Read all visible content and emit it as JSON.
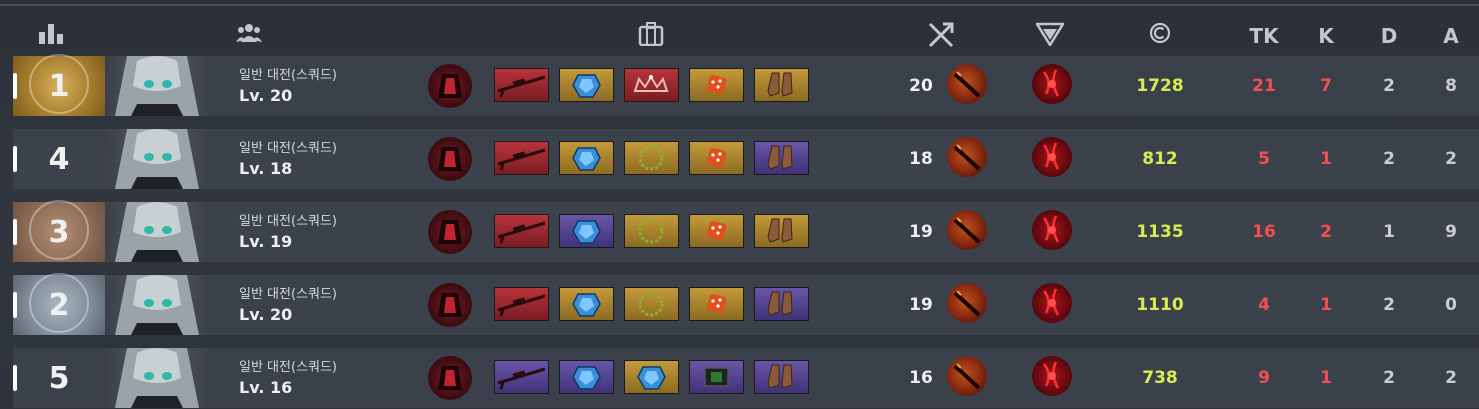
{
  "header": {
    "icons": [
      "ranking-icon",
      "team-icon",
      "inventory-icon",
      "weapon-icon",
      "skill-icon",
      "credit-icon"
    ],
    "tk": "TK",
    "k": "K",
    "d": "D",
    "a": "A"
  },
  "colors": {
    "credits": "#d8ec52",
    "tk_k": "#f05050",
    "text": "#eceef2"
  },
  "rows": [
    {
      "rank": "1",
      "rank_style": "gold",
      "mode": "일반 대전(스쿼드)",
      "level": "Lv. 20",
      "items": [
        "sniper-rifle-red",
        "armor-gold",
        "crown-red",
        "dice-gold",
        "boots-gold"
      ],
      "weapon_level": "20",
      "credits": "1728",
      "tk": "21",
      "k": "7",
      "d": "2",
      "a": "8"
    },
    {
      "rank": "4",
      "rank_style": "plain",
      "mode": "일반 대전(스쿼드)",
      "level": "Lv. 18",
      "items": [
        "sniper-rifle-red",
        "armor-gold",
        "wreath-gold",
        "dice-gold",
        "boots-purple"
      ],
      "weapon_level": "18",
      "credits": "812",
      "tk": "5",
      "k": "1",
      "d": "2",
      "a": "2"
    },
    {
      "rank": "3",
      "rank_style": "bronze",
      "mode": "일반 대전(스쿼드)",
      "level": "Lv. 19",
      "items": [
        "sniper-rifle-red",
        "armor-purple",
        "wreath-gold",
        "dice-gold",
        "boots-gold"
      ],
      "weapon_level": "19",
      "credits": "1135",
      "tk": "16",
      "k": "2",
      "d": "1",
      "a": "9"
    },
    {
      "rank": "2",
      "rank_style": "silver",
      "mode": "일반 대전(스쿼드)",
      "level": "Lv. 20",
      "items": [
        "sniper-rifle-red",
        "armor-gold",
        "wreath-gold",
        "dice-gold",
        "boots-purple"
      ],
      "weapon_level": "19",
      "credits": "1110",
      "tk": "4",
      "k": "1",
      "d": "2",
      "a": "0"
    },
    {
      "rank": "5",
      "rank_style": "plain",
      "mode": "일반 대전(스쿼드)",
      "level": "Lv. 16",
      "items": [
        "sniper-rifle-purple",
        "armor-purple",
        "armor-gold",
        "chip-purple",
        "boots-purple"
      ],
      "weapon_level": "16",
      "credits": "738",
      "tk": "9",
      "k": "1",
      "d": "2",
      "a": "2"
    }
  ]
}
